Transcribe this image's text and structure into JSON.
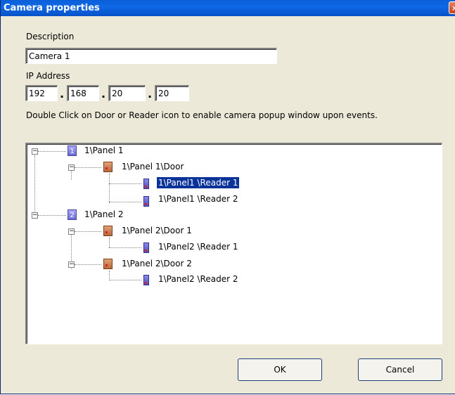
{
  "window": {
    "title": "Camera properties",
    "close_glyph": "×"
  },
  "form": {
    "description_label": "Description",
    "description_value": "Camera 1",
    "ip_label": "IP Address",
    "ip_octets": [
      "192",
      "168",
      "20",
      "20"
    ],
    "ip_separator": ".",
    "instructions": "Double Click on Door or Reader icon to enable camera popup window upon events."
  },
  "tree": {
    "expander_glyph": "−",
    "nodes": [
      {
        "label": "1\\Panel 1",
        "icon": "panel-icon",
        "icon_text": "1"
      },
      {
        "label": "1\\Panel 1\\Door",
        "icon": "door-icon"
      },
      {
        "label": "1\\Panel1 \\Reader 1",
        "icon": "reader-icon",
        "selected": true
      },
      {
        "label": "1\\Panel1 \\Reader 2",
        "icon": "reader-icon"
      },
      {
        "label": "1\\Panel 2",
        "icon": "panel-icon",
        "icon_text": "2"
      },
      {
        "label": "1\\Panel 2\\Door 1",
        "icon": "door-icon"
      },
      {
        "label": "1\\Panel2 \\Reader 1",
        "icon": "reader-icon"
      },
      {
        "label": "1\\Panel 2\\Door 2",
        "icon": "door-icon"
      },
      {
        "label": "1\\Panel2 \\Reader 2",
        "icon": "reader-icon"
      }
    ]
  },
  "buttons": {
    "ok_label": "OK",
    "cancel_label": "Cancel"
  },
  "colors": {
    "titlebar": "#0a5fd8",
    "dialog_bg": "#ece9d8",
    "selection": "#0a3399"
  }
}
